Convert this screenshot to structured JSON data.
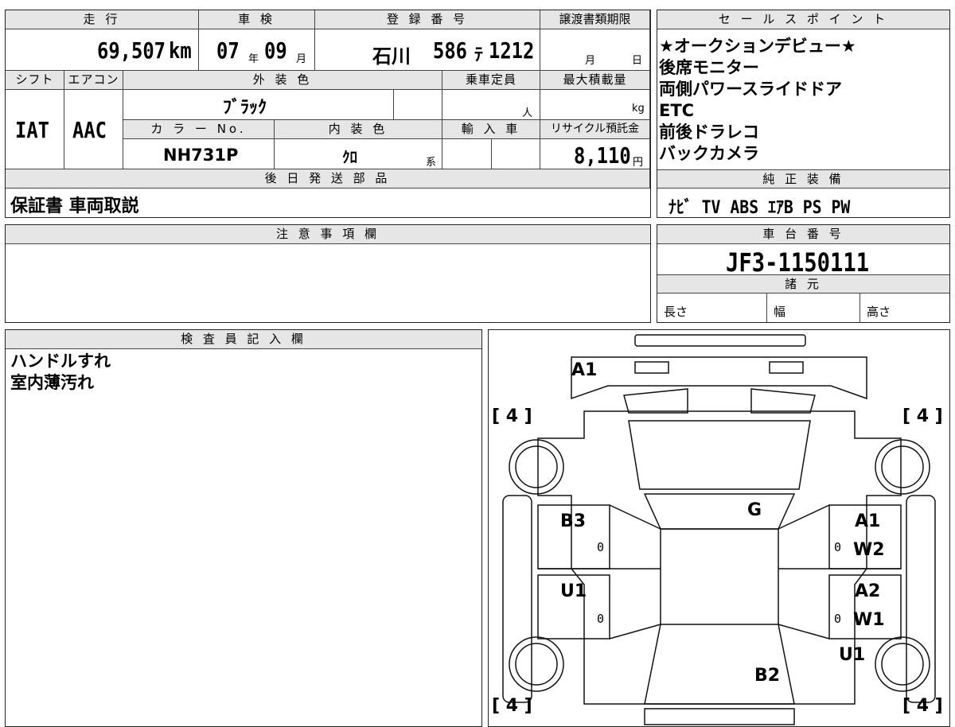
{
  "top": {
    "mileage_h": "走 行",
    "mileage": "69,507",
    "mileage_unit": "km",
    "inspection_h": "車 検",
    "insp_year": "07",
    "insp_year_unit": "年",
    "insp_month": "09",
    "insp_month_unit": "月",
    "reg_h": "登 録 番 号",
    "reg_region": "石川",
    "reg_class": "586",
    "reg_kana": "ﾃ",
    "reg_number": "1212",
    "deadline_h": "譲渡書類期限",
    "deadline_month": "月",
    "deadline_day": "日"
  },
  "row2": {
    "shift_h": "シフト",
    "shift": "IAT",
    "ac_h": "エアコン",
    "ac": "AAC",
    "ext_color_h": "外 装 色",
    "ext_color": "ﾌﾞﾗｯｸ",
    "capacity_h": "乗車定員",
    "capacity_unit": "人",
    "maxload_h": "最大積載量",
    "maxload_unit": "kg",
    "colorno_h": "カ ラ ー No.",
    "colorno": "NH731P",
    "int_color_h": "内 装 色",
    "int_color": "ｸﾛ",
    "int_color_suffix": "系",
    "import_h": "輸 入 車",
    "recycle_h": "リサイクル預託金",
    "recycle": "8,110",
    "recycle_unit": "円"
  },
  "later_parts": {
    "header": "後 日 発 送 部 品",
    "value": "保証書 車両取説"
  },
  "notes": {
    "header": "注 意 事 項 欄"
  },
  "sales": {
    "header": "セ ー ル ス ポ イ ン ト",
    "lines": [
      "★オークションデビュー★",
      "後席モニター",
      "両側パワースライドドア",
      "ETC",
      "前後ドラレコ",
      "バックカメラ"
    ]
  },
  "equipment": {
    "header": "純 正 装 備",
    "value": "ﾅﾋﾞ TV ABS ｴｱB PS PW"
  },
  "chassis": {
    "header": "車 台 番 号",
    "value": "JF3-1150111"
  },
  "specs": {
    "header": "諸 元",
    "length": "長さ",
    "width": "幅",
    "height": "高さ"
  },
  "inspector": {
    "header": "検 査 員 記 入 欄",
    "lines": [
      "ハンドルすれ",
      "室内薄汚れ"
    ]
  },
  "diagram": {
    "labels": {
      "front": "A1",
      "tire_fl": "[ 4 ]",
      "tire_fr": "[ 4 ]",
      "tire_rl": "[ 4 ]",
      "tire_rr": "[ 4 ]",
      "glass": "G",
      "left_front_door": "B3",
      "left_rear_door": "U1",
      "right_front_door_a": "A1",
      "right_front_door_b": "W2",
      "right_rear_door_a": "A2",
      "right_rear_door_b": "W1",
      "right_rear_u": "U1",
      "rear": "B2",
      "zero1": "0",
      "zero2": "0",
      "zero3": "0",
      "zero4": "0"
    }
  }
}
